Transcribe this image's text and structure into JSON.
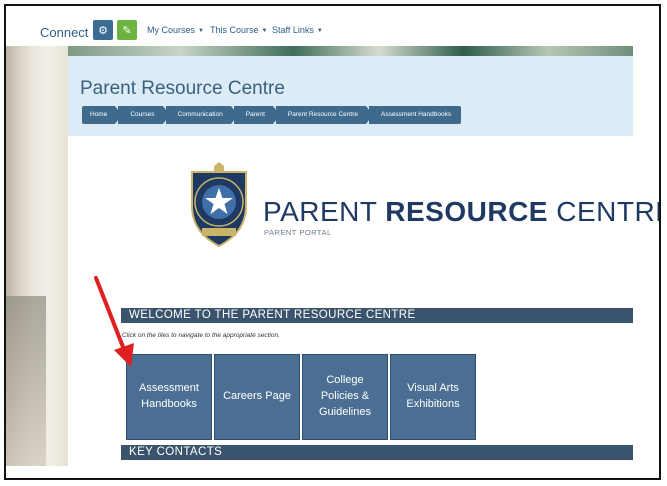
{
  "topnav": {
    "brand": "Connect",
    "settings_icon": "gears-icon",
    "edit_icon": "edit-icon",
    "menus": [
      "My Courses",
      "This Course",
      "Staff Links"
    ]
  },
  "header": {
    "title": "Parent Resource Centre",
    "breadcrumb": [
      "Home",
      "Courses",
      "Communication",
      "Parent",
      "Parent Resource Centre",
      "Assessment Handbooks"
    ]
  },
  "logo": {
    "title_light": "PARENT ",
    "title_bold": "RESOURCE",
    "title_end": " CENTRE",
    "subtitle": "PARENT PORTAL"
  },
  "welcome": {
    "heading": "WELCOME TO THE PARENT RESOURCE CENTRE",
    "hint": "Click on the tiles to navigate to the appropriate section."
  },
  "tiles": [
    {
      "label": "Assessment Handbooks"
    },
    {
      "label": "Careers Page"
    },
    {
      "label": "College Policies & Guidelines"
    },
    {
      "label": "Visual Arts Exhibitions"
    }
  ],
  "contacts": {
    "heading": "KEY CONTACTS"
  },
  "colors": {
    "tile": "#4a6f93",
    "section_bar": "#3b546d",
    "breadcrumb": "#3f6a8c",
    "header_band": "#dcecf6",
    "arrow": "#e02020"
  }
}
